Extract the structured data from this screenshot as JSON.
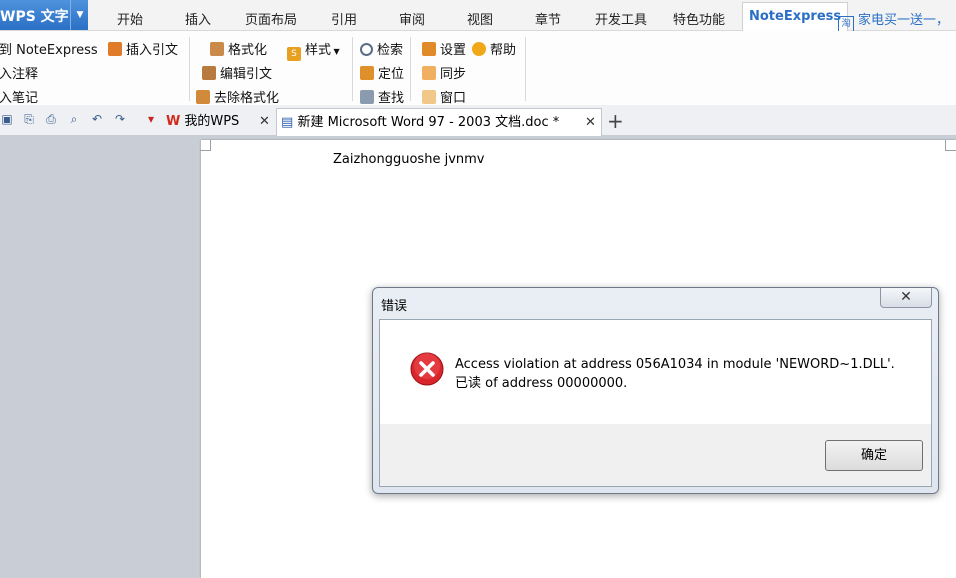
{
  "app": {
    "name": "WPS 文字",
    "tabs": [
      "开始",
      "插入",
      "页面布局",
      "引用",
      "审阅",
      "视图",
      "章节",
      "开发工具",
      "特色功能",
      "NoteExpress"
    ],
    "active_tab": "NoteExpress",
    "ad_text": "家电买一送一，"
  },
  "ribbon": {
    "col1": [
      "转到 NoteExpress",
      "插入注释",
      "插入笔记"
    ],
    "insert_citation": "插入引文",
    "col2": [
      "格式化",
      "编辑引文",
      "去除格式化"
    ],
    "style": "样式",
    "col3": [
      "检索",
      "定位",
      "查找"
    ],
    "col4": [
      "设置",
      "同步",
      "窗口"
    ],
    "help": "帮助"
  },
  "doc_tabs": {
    "wps": "我的WPS",
    "document": "新建 Microsoft Word 97 - 2003 文档.doc *"
  },
  "document": {
    "text": "Zaizhongguoshe jvnmv"
  },
  "dialog": {
    "title": "错误",
    "message": "Access violation at address 056A1034 in module 'NEWORD~1.DLL'. 已读 of address 00000000.",
    "ok": "确定"
  },
  "colors": {
    "accent": "#2a6fc5",
    "error_icon": "#d9262c"
  }
}
